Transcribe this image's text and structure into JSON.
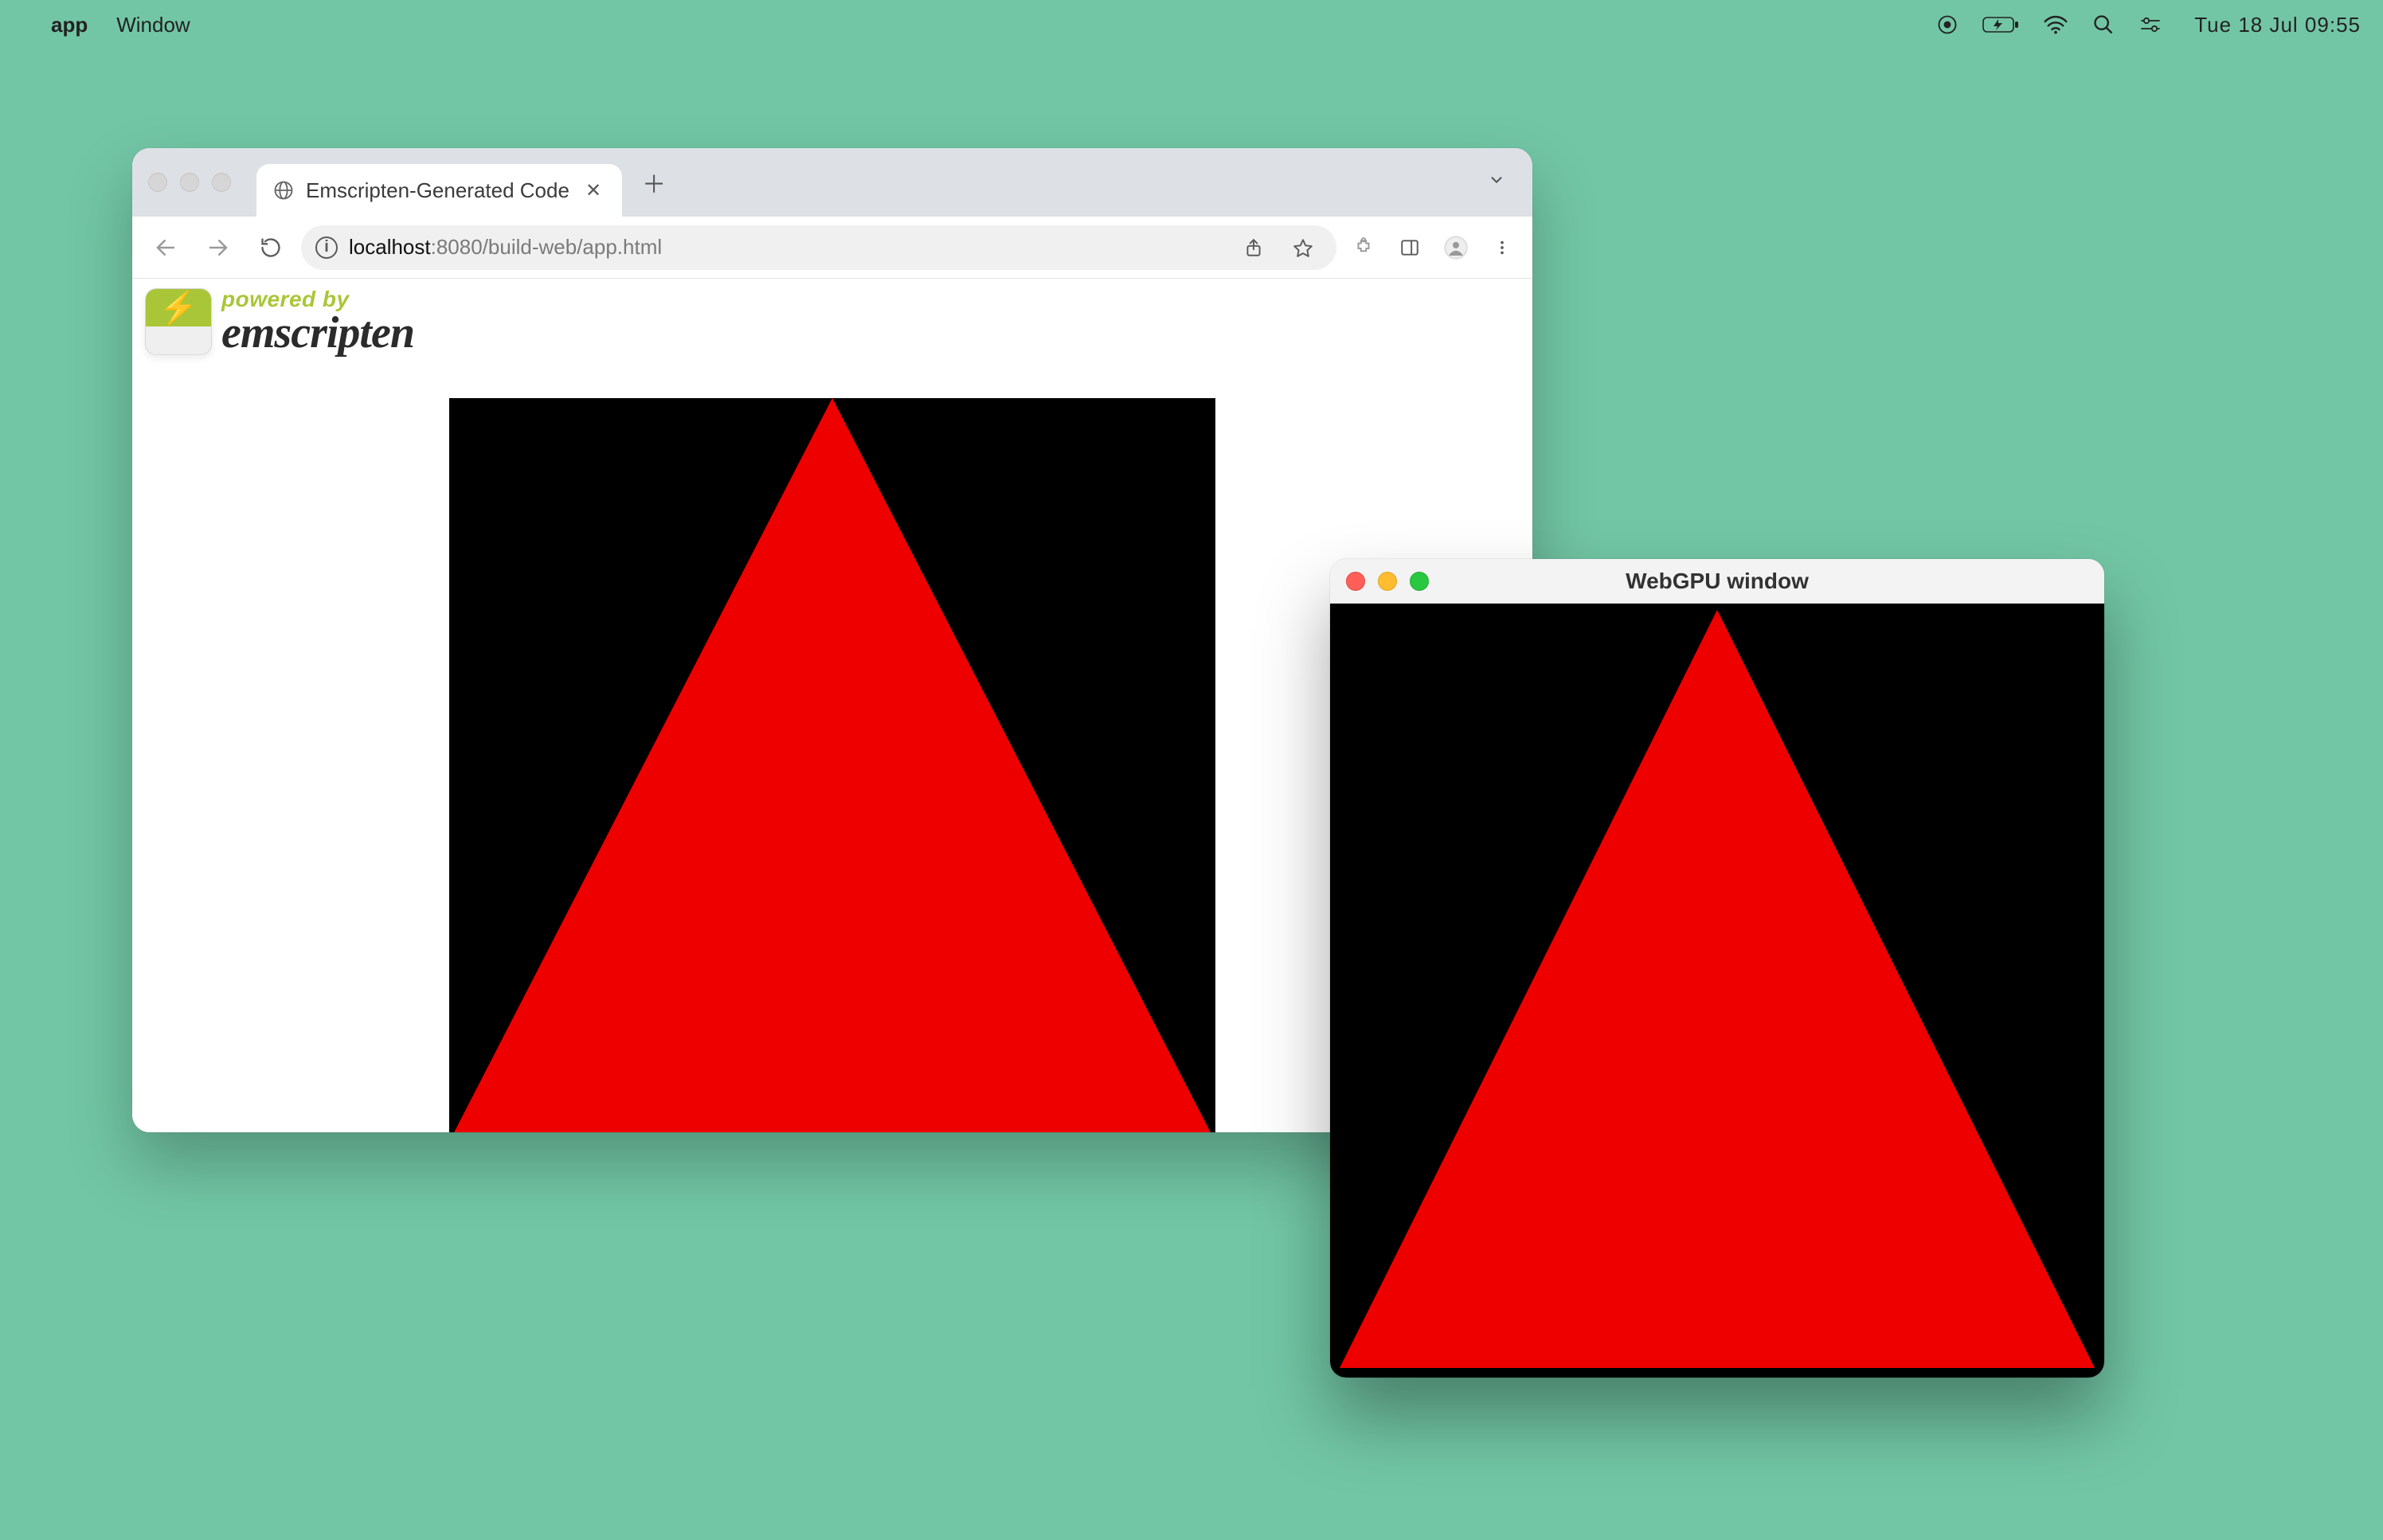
{
  "menubar": {
    "app_name": "app",
    "menu_window": "Window",
    "clock": "Tue 18 Jul  09:55"
  },
  "browser": {
    "tab_title": "Emscripten-Generated Code",
    "url_host": "localhost",
    "url_rest": ":8080/build-web/app.html",
    "emscripten_powered_by": "powered by",
    "emscripten_word": "emscripten"
  },
  "native": {
    "title": "WebGPU window"
  },
  "colors": {
    "desktop": "#72C6A5",
    "triangle": "#EE0000",
    "canvas_bg": "#000000"
  }
}
